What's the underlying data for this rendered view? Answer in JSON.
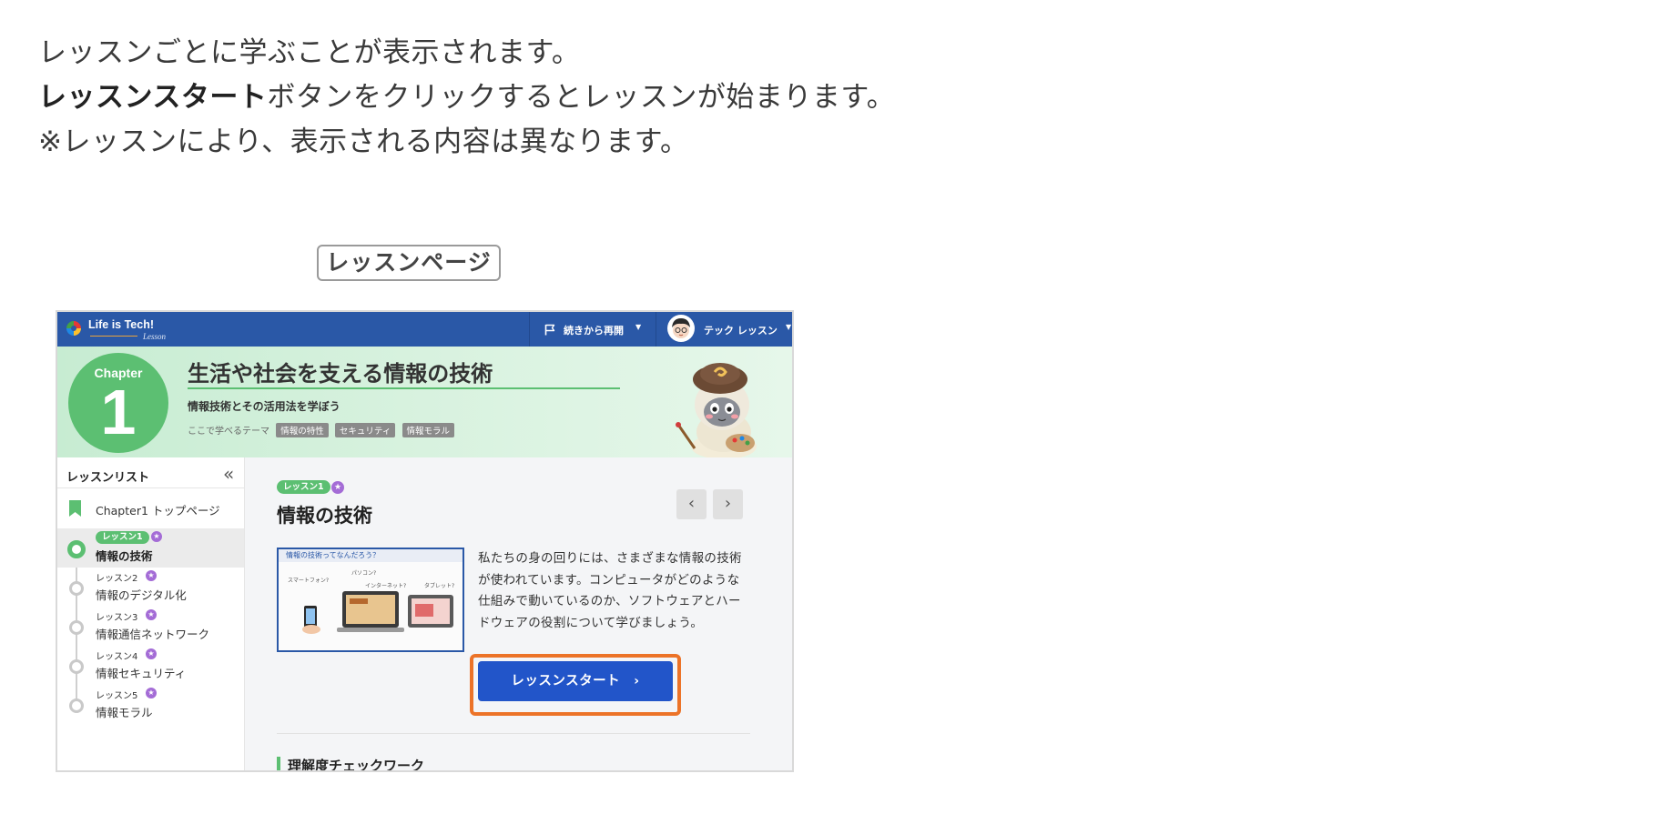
{
  "intro": {
    "line1": "レッスンごとに学ぶことが表示されます。",
    "line2_bold": "レッスンスタート",
    "line2_rest": "ボタンをクリックするとレッスンが始まります。",
    "line3": "※レッスンにより、表示される内容は異なります。"
  },
  "page_label": "レッスンページ",
  "topbar": {
    "logo_text": "Life is Tech!",
    "logo_sub": "Lesson",
    "resume_label": "続きから再開",
    "user_name": "テック レッスン"
  },
  "hero": {
    "chapter_word": "Chapter",
    "chapter_number": "1",
    "title": "生活や社会を支える情報の技術",
    "subtitle": "情報技術とその活用法を学ぼう",
    "themes_label": "ここで学べるテーマ",
    "themes": [
      "情報の特性",
      "セキュリティ",
      "情報モラル"
    ]
  },
  "sidebar": {
    "title": "レッスンリスト",
    "collapse_icon": "«",
    "top_item": "Chapter1 トップページ",
    "lessons": [
      {
        "label": "レッスン1",
        "name": "情報の技術"
      },
      {
        "label": "レッスン2",
        "name": "情報のデジタル化"
      },
      {
        "label": "レッスン3",
        "name": "情報通信ネットワーク"
      },
      {
        "label": "レッスン4",
        "name": "情報セキュリティ"
      },
      {
        "label": "レッスン5",
        "name": "情報モラル"
      }
    ]
  },
  "main": {
    "badge": "レッスン1",
    "title": "情報の技術",
    "prev_icon": "‹",
    "next_icon": "›",
    "thumb_caption": "情報の技術ってなんだろう？",
    "description": "私たちの身の回りには、さまざまな情報の技術が使われています。コンピュータがどのような仕組みで動いているのか、ソフトウェアとハードウェアの役割について学びましょう。",
    "start_button": "レッスンスタート　›",
    "section_title": "理解度チェックワーク"
  },
  "colors": {
    "topbar": "#2a58a7",
    "accent_green": "#5cbf72",
    "button_blue": "#2255c9",
    "highlight_orange": "#ec7328",
    "star_purple": "#a46cd6"
  }
}
